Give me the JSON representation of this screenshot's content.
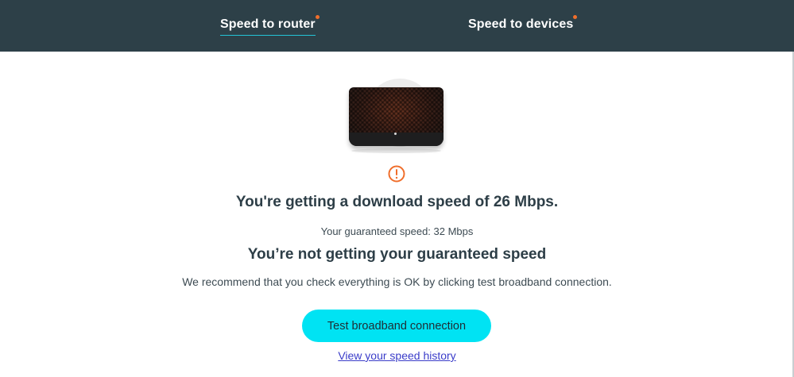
{
  "tabs": {
    "router": "Speed to router",
    "devices": "Speed to devices"
  },
  "status": {
    "icon": "warning-icon",
    "headline": "You're getting a download speed of 26 Mbps.",
    "guaranteed": "Your guaranteed speed: 32 Mbps",
    "subhead": "You’re not getting your guaranteed speed",
    "recommend": "We recommend that you check everything is OK by clicking test broadband connection."
  },
  "actions": {
    "test_button": "Test broadband connection",
    "history_link": "View your speed history"
  },
  "colors": {
    "header_bg": "#2d4048",
    "accent_dot": "#f06e2b",
    "tab_underline": "#23c4d6",
    "button_bg": "#00e3f3",
    "link": "#3a3cc9",
    "warning": "#f06e2b"
  }
}
